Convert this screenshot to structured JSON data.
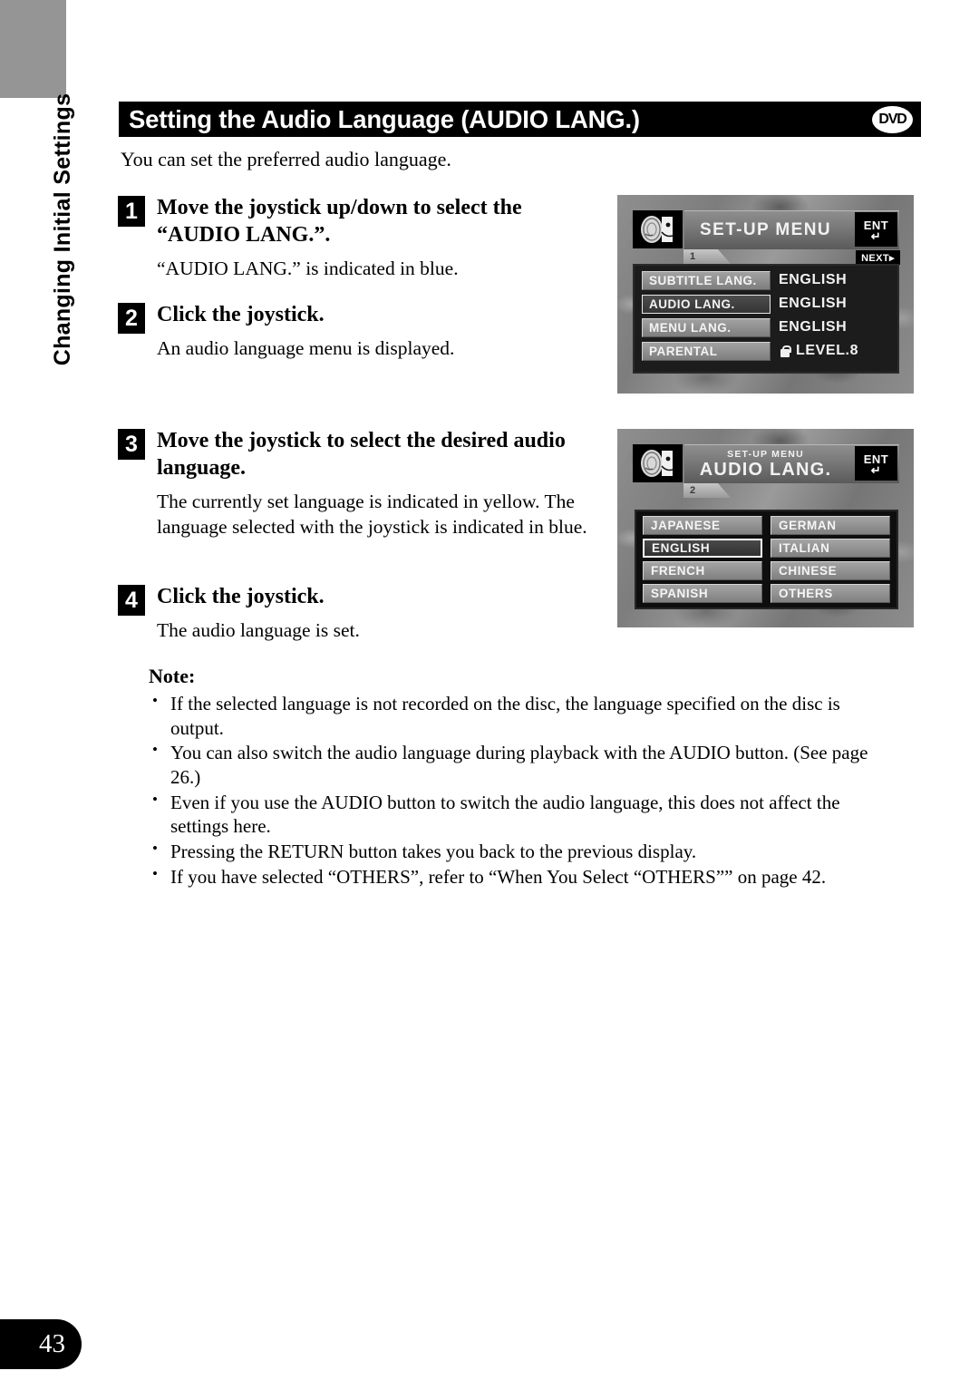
{
  "page": {
    "number": "43",
    "side_tab": "Changing Initial Settings"
  },
  "header": {
    "title": "Setting the Audio Language (AUDIO LANG.)",
    "badge": "DVD"
  },
  "intro": "You can set the preferred audio language.",
  "steps": [
    {
      "num": "1",
      "title": "Move the joystick up/down to select the “AUDIO LANG.”.",
      "desc": "“AUDIO LANG.” is indicated in blue."
    },
    {
      "num": "2",
      "title": "Click the joystick.",
      "desc": "An audio language menu is displayed."
    },
    {
      "num": "3",
      "title": "Move the joystick to select the desired audio language.",
      "desc": "The currently set language is indicated in yellow. The language selected with the joystick is indicated in blue."
    },
    {
      "num": "4",
      "title": "Click the joystick.",
      "desc": "The audio language is set."
    }
  ],
  "note": {
    "heading": "Note:",
    "items": [
      "If the selected language is not recorded on the disc, the language specified on the disc is output.",
      "You can also switch the audio language during playback with the AUDIO button. (See page 26.)",
      "Even if you use the AUDIO button to switch the audio language, this does not affect the settings here.",
      "Pressing the RETURN button takes you back to the previous display.",
      "If you have selected “OTHERS”, refer to “When You Select “OTHERS”” on page 42."
    ]
  },
  "screen1": {
    "title": "SET-UP MENU",
    "ent_label": "ENT",
    "next_label": "NEXT▸",
    "tab_number": "1",
    "rows": [
      {
        "label": "SUBTITLE LANG.",
        "value": "ENGLISH",
        "selected": false
      },
      {
        "label": "AUDIO LANG.",
        "value": "ENGLISH",
        "selected": true
      },
      {
        "label": "MENU LANG.",
        "value": "ENGLISH",
        "selected": false
      },
      {
        "label": "PARENTAL",
        "value": "LEVEL.8",
        "selected": false
      }
    ]
  },
  "screen2": {
    "subtitle": "SET-UP MENU",
    "title": "AUDIO LANG.",
    "ent_label": "ENT",
    "tab_number": "2",
    "languages": [
      {
        "label": "JAPANESE",
        "selected": false
      },
      {
        "label": "GERMAN",
        "selected": false
      },
      {
        "label": "ENGLISH",
        "selected": true
      },
      {
        "label": "ITALIAN",
        "selected": false
      },
      {
        "label": "FRENCH",
        "selected": false
      },
      {
        "label": "CHINESE",
        "selected": false
      },
      {
        "label": "SPANISH",
        "selected": false
      },
      {
        "label": "OTHERS",
        "selected": false
      }
    ]
  },
  "colors": {
    "header_bg": "#000000",
    "corner_block": "#959595",
    "page_tab": "#000000"
  }
}
